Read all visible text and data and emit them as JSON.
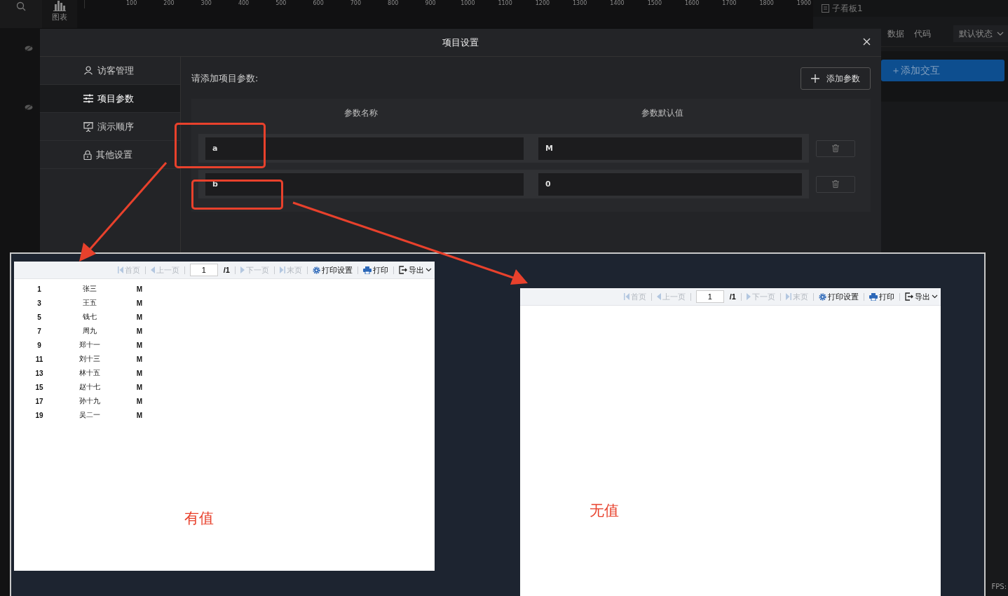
{
  "top_bar": {
    "chart_tab": "图表",
    "ruler_ticks": [
      "100",
      "200",
      "300",
      "400",
      "500",
      "600",
      "700",
      "800",
      "900",
      "1000",
      "1100",
      "1200",
      "1300",
      "1400",
      "1500",
      "1600",
      "1700",
      "1800",
      "1900"
    ]
  },
  "right_panel": {
    "title": "子看板1",
    "tabs": [
      "数据",
      "代码"
    ],
    "state_dropdown": "默认状态",
    "add_interaction_button": "＋添加交互"
  },
  "dialog": {
    "title": "项目设置",
    "sidebar": [
      {
        "kind": "visitor",
        "label": "访客管理",
        "selected": false
      },
      {
        "kind": "params",
        "label": "项目参数",
        "selected": true
      },
      {
        "kind": "presentation",
        "label": "演示顺序",
        "selected": false
      },
      {
        "kind": "other",
        "label": "其他设置",
        "selected": false
      }
    ],
    "prompt": "请添加项目参数:",
    "add_button": "添加参数",
    "columns": [
      "参数名称",
      "参数默认值"
    ],
    "params": [
      {
        "name": "a",
        "value": "M"
      },
      {
        "name": "b",
        "value": "0"
      }
    ]
  },
  "reports": [
    {
      "toolbar": [
        {
          "kind": "first",
          "label": "首页",
          "disabled": true
        },
        {
          "kind": "prev",
          "label": "上一页",
          "disabled": true
        },
        {
          "kind": "page_input",
          "label": "1"
        },
        {
          "kind": "page_total",
          "label": "/1"
        },
        {
          "kind": "next",
          "label": "下一页",
          "disabled": true
        },
        {
          "kind": "last",
          "label": "末页",
          "disabled": true
        },
        {
          "kind": "print_settings",
          "label": "打印设置",
          "disabled": false
        },
        {
          "kind": "print",
          "label": "打印",
          "disabled": false
        },
        {
          "kind": "export",
          "label": "导出",
          "disabled": false
        }
      ],
      "rows": [
        {
          "no": "1",
          "name": "张三",
          "value": "M"
        },
        {
          "no": "3",
          "name": "王五",
          "value": "M"
        },
        {
          "no": "5",
          "name": "钱七",
          "value": "M"
        },
        {
          "no": "7",
          "name": "周九",
          "value": "M"
        },
        {
          "no": "9",
          "name": "郑十一",
          "value": "M"
        },
        {
          "no": "11",
          "name": "刘十三",
          "value": "M"
        },
        {
          "no": "13",
          "name": "林十五",
          "value": "M"
        },
        {
          "no": "15",
          "name": "赵十七",
          "value": "M"
        },
        {
          "no": "17",
          "name": "孙十九",
          "value": "M"
        },
        {
          "no": "19",
          "name": "吴二一",
          "value": "M"
        }
      ],
      "note": "有值"
    },
    {
      "toolbar": [
        {
          "kind": "first",
          "label": "首页",
          "disabled": true
        },
        {
          "kind": "prev",
          "label": "上一页",
          "disabled": true
        },
        {
          "kind": "page_input",
          "label": "1"
        },
        {
          "kind": "page_total",
          "label": "/1"
        },
        {
          "kind": "next",
          "label": "下一页",
          "disabled": true
        },
        {
          "kind": "last",
          "label": "末页",
          "disabled": true
        },
        {
          "kind": "print_settings",
          "label": "打印设置",
          "disabled": false
        },
        {
          "kind": "print",
          "label": "打印",
          "disabled": false
        },
        {
          "kind": "export",
          "label": "导出",
          "disabled": false
        }
      ],
      "note": "无值"
    }
  ],
  "fps": "FPS:"
}
